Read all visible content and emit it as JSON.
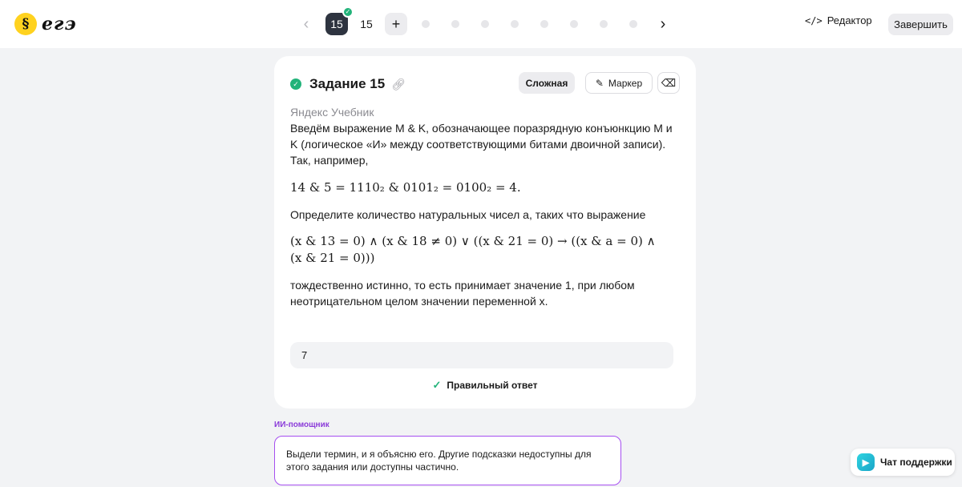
{
  "header": {
    "logo_glyph": "§",
    "logo_text": "егэ",
    "prev_arrow": "‹",
    "next_arrow": "›",
    "active_task": "15",
    "next_task": "15",
    "add_label": "+",
    "editor_label": "Редактор",
    "editor_icon": "</>",
    "finish_label": "Завершить"
  },
  "task": {
    "title": "Задание 15",
    "difficulty": "Сложная",
    "marker_label": "Маркер",
    "source": "Яндекс Учебник",
    "intro": "Введём выражение M & K, обозначающее поразрядную конъюнкцию M и K (логическое «И» между соответствующими битами двоичной записи). Так, например,",
    "example_formula": "14 & 5 = 1110₂ & 0101₂ = 0100₂ = 4.",
    "question": "Определите количество натуральных чисел a, таких что выражение",
    "main_formula_line1": "(x & 13 = 0) ∧ (x & 18 ≠ 0) ∨ ((x & 21 = 0) → ((x & a = 0) ∧",
    "main_formula_line2": "(x & 21 = 0)))",
    "condition": "тождественно истинно, то есть принимает значение 1, при любом неотрицательном целом значении переменной x.",
    "answer_value": "7",
    "result_label": "Правильный ответ"
  },
  "ai": {
    "label": "ИИ-помощник",
    "message": "Выдели термин, и я объясню его. Другие подсказки недоступны для этого задания или доступны частично."
  },
  "support": {
    "label": "Чат поддержки"
  },
  "colors": {
    "success": "#22b37a",
    "ai_accent": "#a64ff0",
    "active_task_bg": "#2e3440",
    "brand_yellow": "#ffd21f"
  }
}
